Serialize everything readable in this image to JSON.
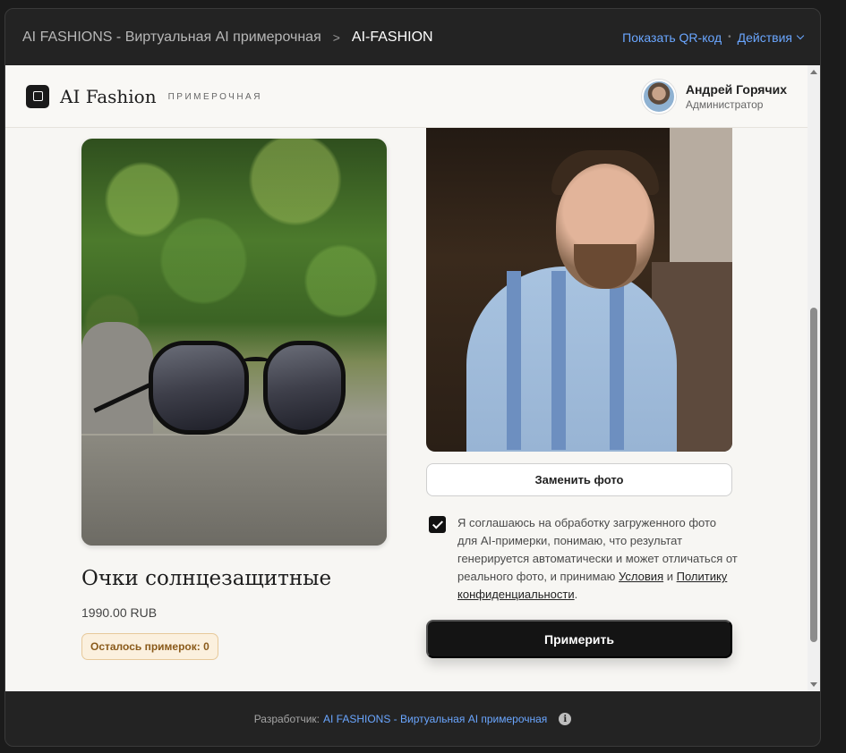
{
  "window": {
    "breadcrumb_app": "AI FASHIONS - Виртуальная AI примерочная",
    "breadcrumb_separator": ">",
    "breadcrumb_current": "AI-FASHION",
    "show_qr_label": "Показать QR-код",
    "actions_label": "Действия"
  },
  "header": {
    "brand": "AI Fashion",
    "brand_sub": "ПРИМЕРОЧНАЯ",
    "user_name": "Андрей Горячих",
    "user_role": "Администратор"
  },
  "product": {
    "title": "Очки солнцезащитные",
    "price": "1990.00 RUB",
    "tries_left": "Осталось примерок: 0"
  },
  "tryon": {
    "replace_photo_label": "Заменить фото",
    "consent_checked": true,
    "consent_text_1": "Я соглашаюсь на обработку загруженного фото для AI-примерки, понимаю, что результат генерируется автоматически и может отличаться от реального фото, и принимаю",
    "terms_link": "Условия",
    "consent_and": "и",
    "privacy_link": "Политику конфиденциальности",
    "consent_end": ".",
    "try_button_label": "Примерить"
  },
  "footer": {
    "developer_label": "Разработчик:",
    "developer_link": "AI FASHIONS - Виртуальная AI примерочная"
  },
  "icons": {
    "logo": "square-logo-icon",
    "chevron": "chevron-down-icon",
    "info": "info-icon",
    "check": "check-icon"
  }
}
